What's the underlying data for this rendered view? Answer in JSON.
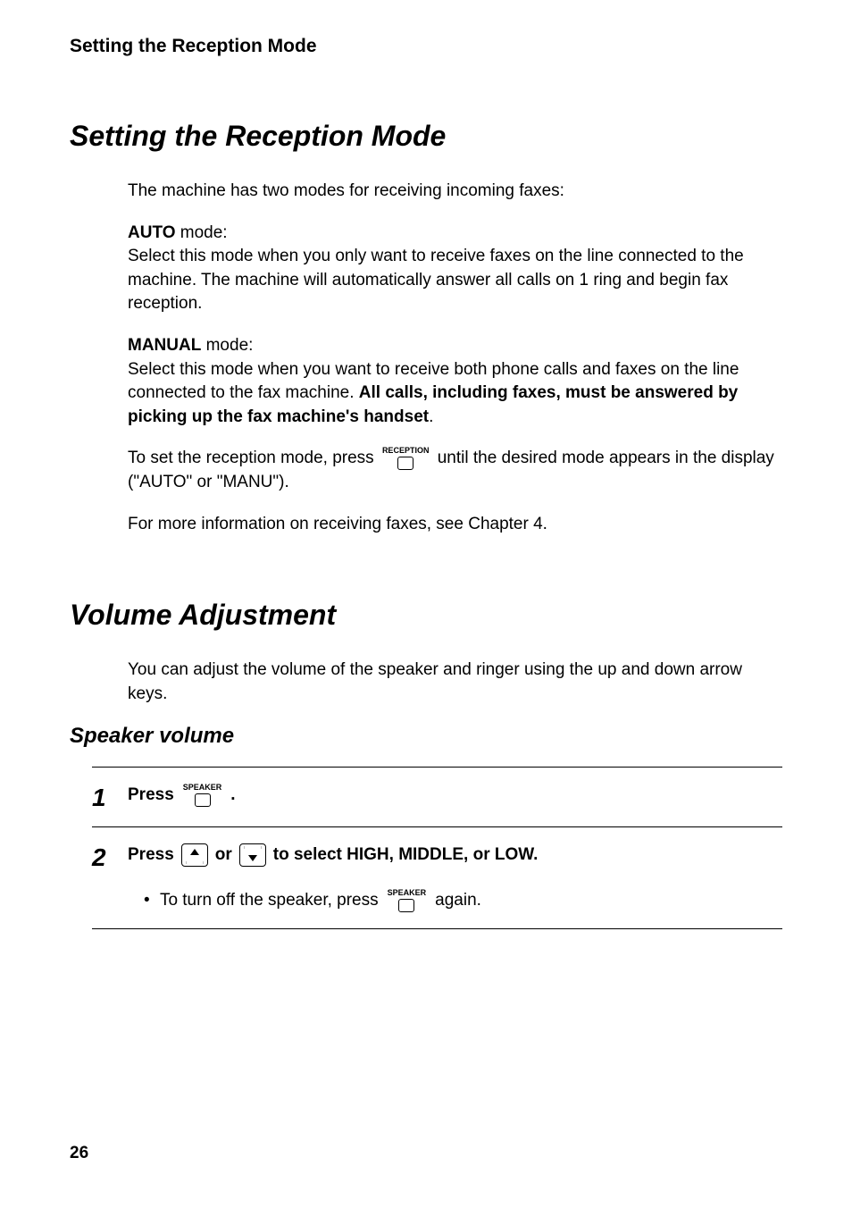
{
  "header": "Setting the Reception Mode",
  "section1": {
    "title": "Setting the Reception Mode",
    "intro": "The machine has two modes for receiving incoming faxes:",
    "auto_label": "AUTO",
    "auto_mode_suffix": " mode:",
    "auto_desc": "Select this mode when you only want to receive faxes on the line connected to the machine. The machine will automatically answer all calls on 1 ring and begin fax reception.",
    "manual_label": "MANUAL",
    "manual_mode_suffix": " mode:",
    "manual_desc_pre": "Select this mode when you want to receive both phone calls and faxes on the line connected to the fax machine. ",
    "manual_desc_bold": "All calls, including faxes, must be answered by picking up the fax machine's handset",
    "manual_desc_post": ".",
    "set_mode_pre": "To set the reception mode, press ",
    "reception_key_label": "RECEPTION",
    "set_mode_post": " until the desired mode appears in the display (\"AUTO\" or \"MANU\").",
    "more_info": "For more information on receiving faxes, see Chapter 4."
  },
  "section2": {
    "title": "Volume Adjustment",
    "intro": "You can adjust the volume of the speaker and ringer using the up and down arrow keys.",
    "subsection": "Speaker volume",
    "step1_num": "1",
    "step1_press": "Press ",
    "speaker_label": "SPEAKER",
    "step1_end": " .",
    "step2_num": "2",
    "step2_press": "Press ",
    "step2_or": " or ",
    "step2_to": " to select HIGH, MIDDLE, or LOW.",
    "step2_bullet_pre": "To turn off the speaker, press ",
    "step2_bullet_post": " again."
  },
  "page_number": "26"
}
